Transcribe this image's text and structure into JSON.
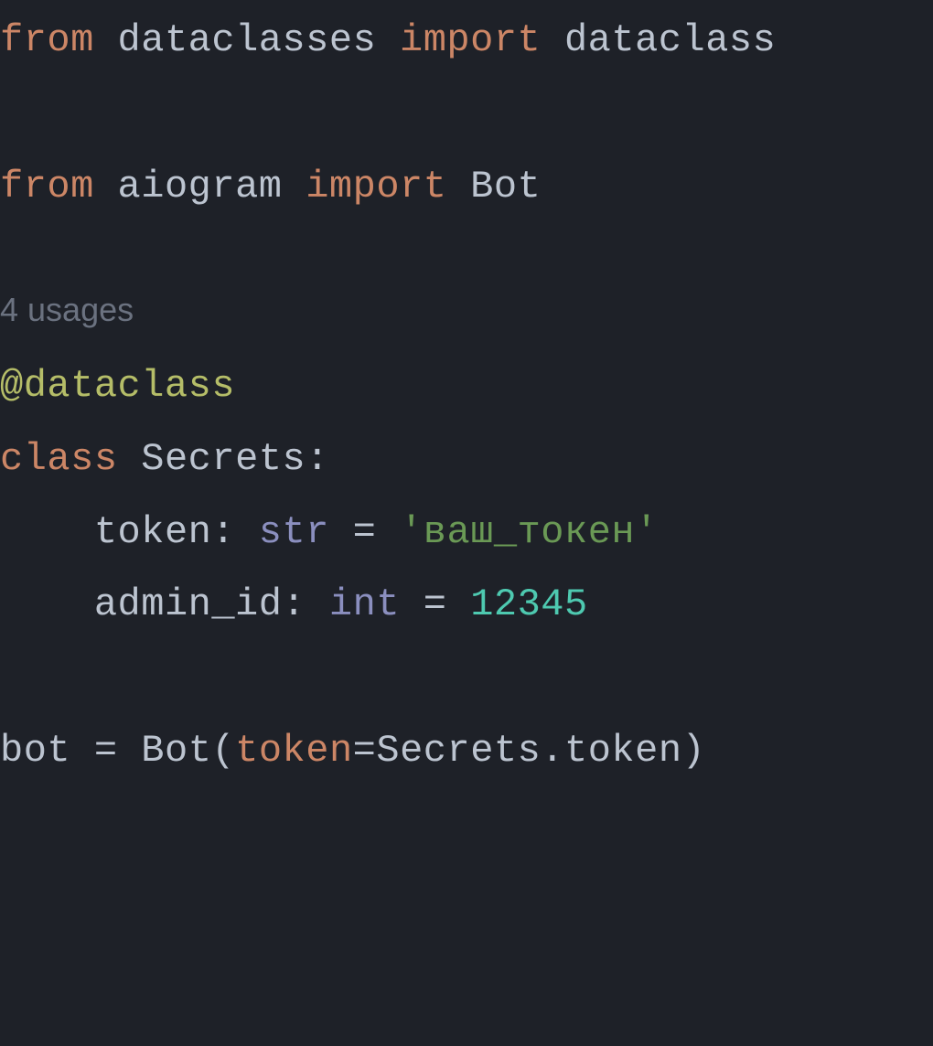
{
  "code": {
    "line1": {
      "from": "from",
      "module": "dataclasses",
      "import": "import",
      "name": "dataclass"
    },
    "line2": {
      "from": "from",
      "module": "aiogram",
      "import": "import",
      "name": "Bot"
    },
    "usages_hint": "4 usages",
    "decorator": "@dataclass",
    "class_kw": "class",
    "class_name": "Secrets",
    "colon": ":",
    "field1": {
      "name": "token",
      "colon": ":",
      "type": "str",
      "eq": "=",
      "value": "'ваш_токен'"
    },
    "field2": {
      "name": "admin_id",
      "colon": ":",
      "type": "int",
      "eq": "=",
      "value": "12345"
    },
    "assign": {
      "lhs": "bot",
      "eq": "=",
      "call": "Bot",
      "lparen": "(",
      "param": "token",
      "peq": "=",
      "arg": "Secrets.token",
      "rparen": ")"
    }
  }
}
